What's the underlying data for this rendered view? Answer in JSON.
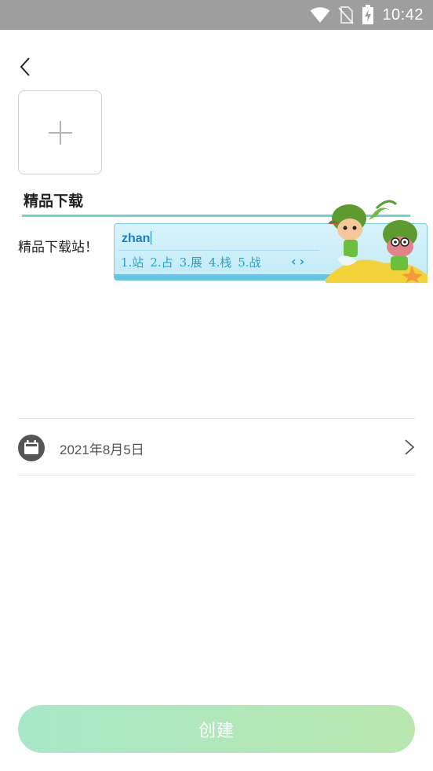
{
  "status_bar": {
    "time": "10:42",
    "icons": [
      "wifi-icon",
      "no-sim-icon",
      "battery-charging-icon"
    ]
  },
  "header": {
    "back_icon": "chevron-left-icon"
  },
  "photo_picker": {
    "icon": "plus-icon"
  },
  "form": {
    "title_value": "精品下载",
    "description_value": "精品下载站！"
  },
  "ime": {
    "pinyin": "zhan",
    "candidates": [
      "1.站",
      "2.占",
      "3.展",
      "4.栈",
      "5.战"
    ],
    "nav_prev": "‹",
    "nav_next": "›"
  },
  "date_row": {
    "icon": "calendar-icon",
    "value": "2021年8月5日",
    "chevron": "chevron-right-icon"
  },
  "actions": {
    "create_label": "创建"
  },
  "colors": {
    "status_bar": "#9e9e9e",
    "input_underline": "#6ed3cf",
    "button_gradient_start": "#a8e8c8",
    "button_gradient_end": "#b9e8ae",
    "ime_text": "#2aa2c7"
  }
}
